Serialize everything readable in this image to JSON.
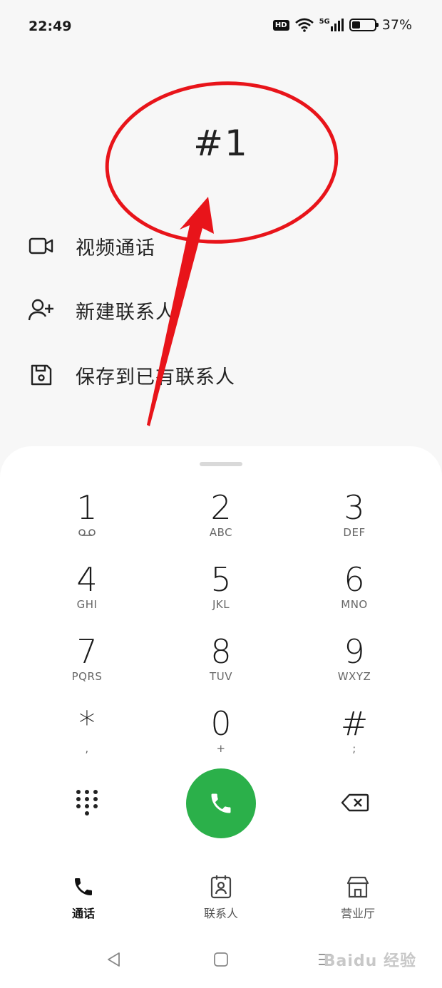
{
  "status_bar": {
    "time": "22:49",
    "hd_label": "HD",
    "network": "5G",
    "battery_percent": "37%",
    "battery_level": 0.37
  },
  "dialed": "#1",
  "actions": [
    {
      "label": "视频通话",
      "icon": "video-camera-icon"
    },
    {
      "label": "新建联系人",
      "icon": "add-person-icon"
    },
    {
      "label": "保存到已有联系人",
      "icon": "save-icon"
    }
  ],
  "keypad": [
    {
      "digit": "1",
      "letters": "",
      "icon": "voicemail-icon"
    },
    {
      "digit": "2",
      "letters": "ABC"
    },
    {
      "digit": "3",
      "letters": "DEF"
    },
    {
      "digit": "4",
      "letters": "GHI"
    },
    {
      "digit": "5",
      "letters": "JKL"
    },
    {
      "digit": "6",
      "letters": "MNO"
    },
    {
      "digit": "7",
      "letters": "PQRS"
    },
    {
      "digit": "8",
      "letters": "TUV"
    },
    {
      "digit": "9",
      "letters": "WXYZ"
    },
    {
      "digit": "*",
      "letters": ","
    },
    {
      "digit": "0",
      "letters": "+"
    },
    {
      "digit": "#",
      "letters": ";"
    }
  ],
  "tabs": [
    {
      "label": "通话",
      "icon": "phone-icon",
      "active": true
    },
    {
      "label": "联系人",
      "icon": "contacts-icon",
      "active": false
    },
    {
      "label": "营业厅",
      "icon": "store-icon",
      "active": false
    }
  ],
  "watermark": "Baidu 经验",
  "colors": {
    "call_button": "#2bb04a",
    "annotation": "#e8141a",
    "background": "#f7f7f7"
  }
}
